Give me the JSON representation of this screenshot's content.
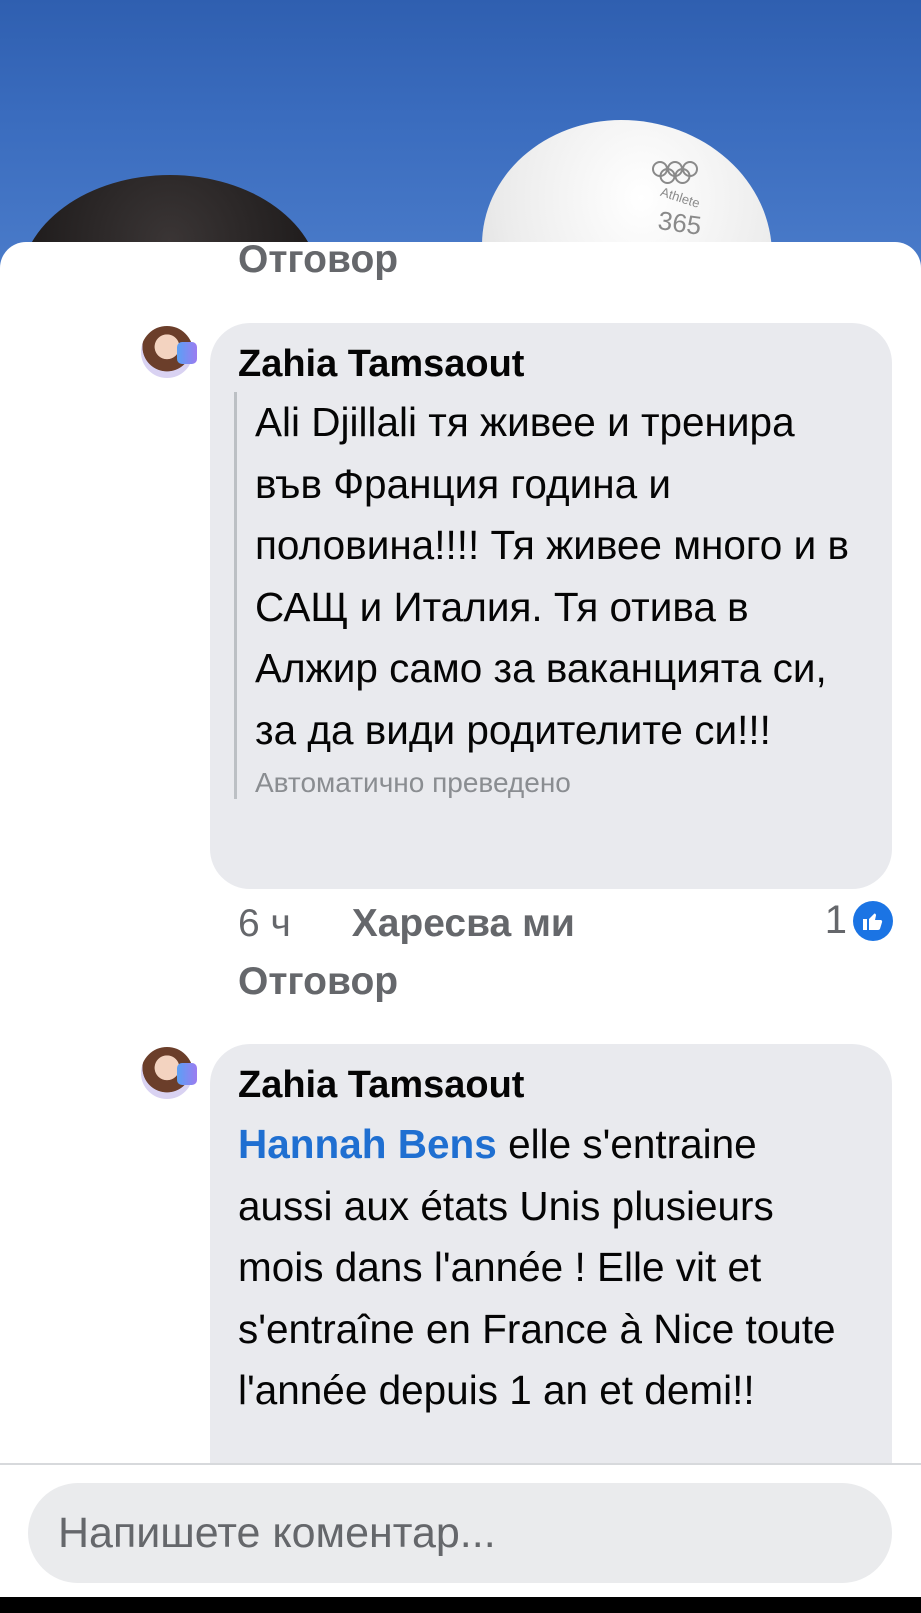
{
  "background": {
    "cap_brand_text": "Athlete",
    "cap_brand_number": "365"
  },
  "top_reply_label": "Отговор",
  "comments": [
    {
      "author": "Zahia Tamsaout",
      "text": "Ali Djillali тя живее и тренира във Франция година и половина!!!! Тя живее много и в САЩ и Италия. Тя отива в Алжир само за ваканцията си, за да види родителите си!!!",
      "translation_note": "Автоматично преведено",
      "time": "6 ч",
      "like_label": "Харесва ми",
      "reply_label": "Отговор",
      "reaction_count": "1",
      "reaction_icon": "thumbs-up-icon"
    },
    {
      "author": "Zahia Tamsaout",
      "mention": "Hannah Bens",
      "text": " elle s'entraine aussi aux états Unis plusieurs mois dans l'année ! Elle vit et s'entraîne en France à Nice toute l'année depuis 1 an et demi!!"
    }
  ],
  "composer": {
    "placeholder": "Напишете коментар..."
  },
  "colors": {
    "bubble": "#e9eaee",
    "mention": "#1f6fd1",
    "like_badge": "#1b74e4",
    "muted_text": "#65676b"
  }
}
